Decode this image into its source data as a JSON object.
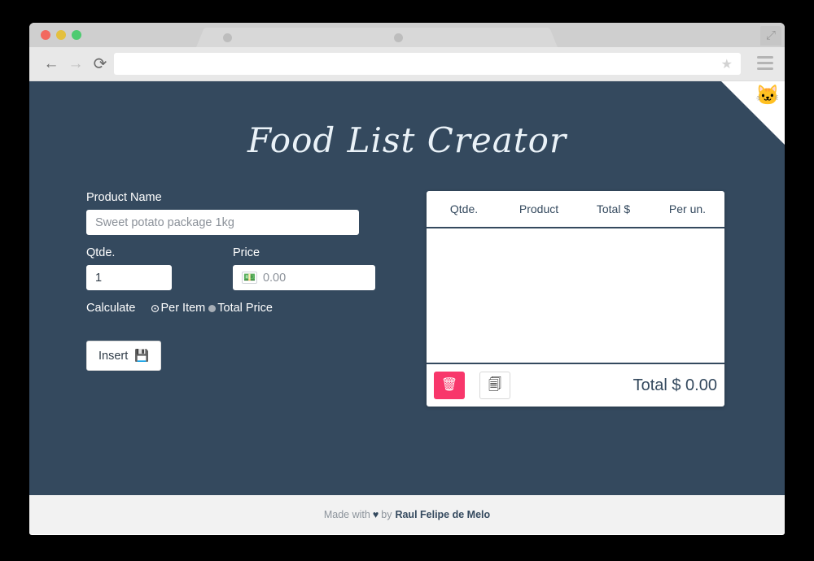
{
  "browser": {
    "tabs": [
      {
        "favicon": "circle-placeholder"
      },
      {
        "favicon": "circle-placeholder"
      }
    ],
    "traffic_lights": [
      "close",
      "minimize",
      "maximize"
    ],
    "back_icon": "←",
    "forward_icon": "→",
    "reload_icon": "⟳",
    "url_value": "",
    "url_placeholder": "",
    "bookmark_icon": "★",
    "menu_icon": "hamburger-menu",
    "resize_icon": "⤢"
  },
  "page": {
    "title": "Food List Creator",
    "github_corner_icon": "🐱",
    "background_color": "#34495e"
  },
  "form": {
    "product_name_label": "Product Name",
    "product_name_placeholder": "Sweet potato package 1kg",
    "product_name_value": "",
    "qtde_label": "Qtde.",
    "qtde_value": "1",
    "price_label": "Price",
    "price_icon": "💵",
    "price_placeholder": "0.00",
    "price_value": "",
    "calculate_label": "Calculate",
    "calculate_options": [
      {
        "label": "Per Item",
        "selected": true
      },
      {
        "label": "Total Price",
        "selected": false
      }
    ],
    "insert_label": "Insert",
    "insert_icon": "💾"
  },
  "table": {
    "headers": [
      "Qtde.",
      "Product",
      "Total $",
      "Per un."
    ],
    "rows": [],
    "delete_icon": "🗑",
    "copy_icon": "🗐",
    "total_label": "Total $ 0.00",
    "accent_delete_color": "#f8376b",
    "border_color": "#34495e"
  },
  "footer": {
    "made_with": "Made with",
    "heart": "♥",
    "by": "by",
    "author": "Raul Felipe de Melo"
  }
}
